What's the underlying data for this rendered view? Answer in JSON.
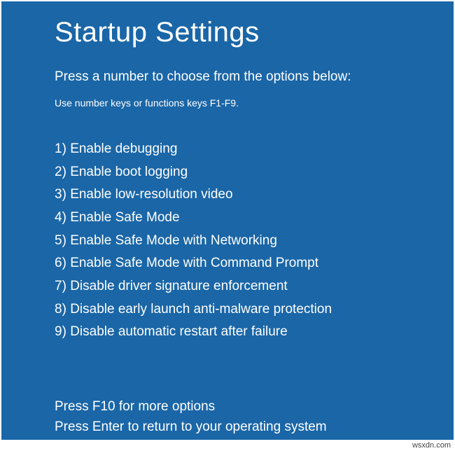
{
  "title": "Startup Settings",
  "subtitle": "Press a number to choose from the options below:",
  "hint": "Use number keys or functions keys F1-F9.",
  "options": [
    {
      "num": "1)",
      "label": "Enable debugging"
    },
    {
      "num": "2)",
      "label": "Enable boot logging"
    },
    {
      "num": "3)",
      "label": "Enable low-resolution video"
    },
    {
      "num": "4)",
      "label": "Enable Safe Mode"
    },
    {
      "num": "5)",
      "label": "Enable Safe Mode with Networking"
    },
    {
      "num": "6)",
      "label": "Enable Safe Mode with Command Prompt"
    },
    {
      "num": "7)",
      "label": "Disable driver signature enforcement"
    },
    {
      "num": "8)",
      "label": "Disable early launch anti-malware protection"
    },
    {
      "num": "9)",
      "label": "Disable automatic restart after failure"
    }
  ],
  "footer": {
    "more": "Press F10 for more options",
    "return": "Press Enter to return to your operating system"
  },
  "watermark": "wsxdn.com"
}
